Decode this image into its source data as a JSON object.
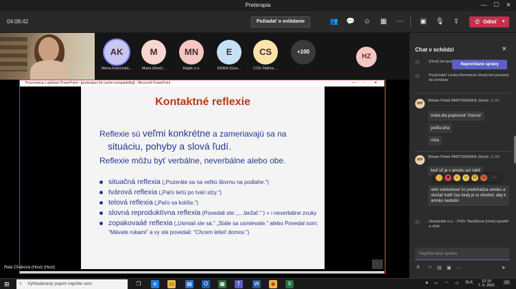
{
  "window": {
    "title": "Preterapia"
  },
  "toolbar": {
    "timer": "04:08:42",
    "raise_request": "Požiadať o ovládanie",
    "leave": "Odísť"
  },
  "participants": [
    {
      "initials": "AK",
      "name": "Alena Kubovská...",
      "color": "#c9c7f1",
      "active": true
    },
    {
      "initials": "M",
      "name": "Maria (Host)...",
      "color": "#f6d6cf",
      "active": false
    },
    {
      "initials": "MN",
      "name": "Maják n.o.",
      "color": "#f4c7c3",
      "active": false
    },
    {
      "initials": "E",
      "name": "ERIKA (Gue...",
      "color": "#c6e0f5",
      "active": false
    },
    {
      "initials": "CS",
      "name": "CSS Sibirka ...",
      "color": "#f9e3a8",
      "active": false
    }
  ],
  "more_count": "+100",
  "hz_initials": "HZ",
  "ppt": {
    "window_title": "Prezentácia v aplikácii PowerPoint - [preterapia SK [režim kompatibility]] - Microsoft PowerPoint"
  },
  "slide": {
    "title": "Kontaktné reflexie",
    "line1_a": "Reflexie sú ",
    "line1_b": "veľmi konkrétne",
    "line1_c": " a zameriavajú sa na",
    "line2": "situáciu, pohyby a slová ľudí.",
    "line3": "Reflexie môžu byť verbálne, neverbálne alebo obe.",
    "bullets": [
      {
        "label": "situačná reflexia",
        "quote": " („Pozeráte sa na veľkú škvrnu na podlahe.“)"
      },
      {
        "label": "tvárová reflexia",
        "quote": " („Paťo tečú po tvári slzy.“)"
      },
      {
        "label": "telová reflexia",
        "quote": " („Paťo sa kolíše.“)"
      },
      {
        "label": "slovná reproduktívna reflexia",
        "quote": " (Povedali ste: „…bežať.“ ) + i neverbálne zvuky"
      },
      {
        "label": "zopakovaáé reflexia",
        "quote": " („Usmiali ste sa.“ „Stále sa usmievate.“ alebo Povedal som: “Mávate rukami” a vy ste povedali: “Chcem letieť domov.”)"
      }
    ]
  },
  "presenter": "Rela Chábová (Host) (Host)",
  "chat": {
    "title": "Chat v schôdzi",
    "unread_label": "Neprečítané správy",
    "sys1": "(Host) bol pozvaný do schôdze.",
    "sys2": "Používateľ Lenka Remetová (Host) bol pozvaný do schôdze.",
    "msg1": {
      "initials": "MP",
      "author": "Miriam Petrik PARTIZÁNSKE (Host)",
      "time": "11:51",
      "lines": [
        "treba iba popisovat' činnost'",
        "podľa pňa",
        "mňa"
      ]
    },
    "msg2": {
      "initials": "MP",
      "author": "Miriam Petrik PARTIZÁNSKE (Host)",
      "time": "11:56",
      "lines": [
        "keď už je v amoku asi robiť",
        "skôr odsledovať čo predchádza amoku a skúšať trafiť čas kedy je to vhodné, aby k amoku nedošlo"
      ]
    },
    "sys3": "Humanitár n.o. - PhDr. Baništová (Host) opustil/-a chat.",
    "input_placeholder": "Napíšte novú správu"
  },
  "taskbar": {
    "search_placeholder": "Vyhľadávaný pojem napíšte sem",
    "lang": "SLK",
    "time": "12:10",
    "date": "7. 5. 2021",
    "badge": "23"
  }
}
